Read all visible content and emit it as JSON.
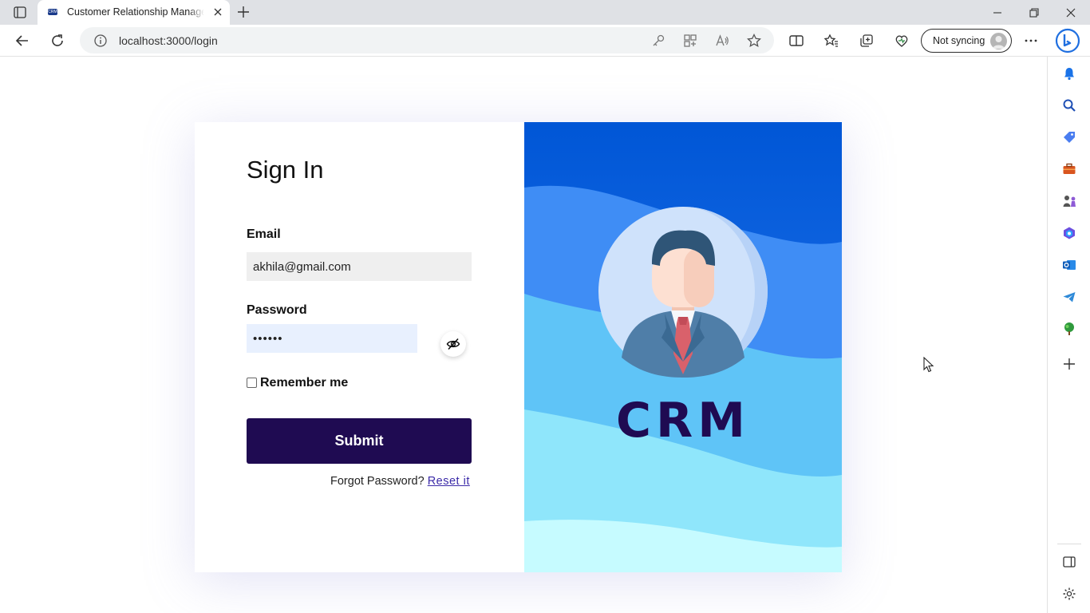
{
  "browser": {
    "tab_title": "Customer Relationship Management",
    "favicon_text": "CRM",
    "url": "localhost:3000/login",
    "sync_label": "Not syncing"
  },
  "login": {
    "title": "Sign In",
    "email_label": "Email",
    "email_value": "akhila@gmail.com",
    "password_label": "Password",
    "password_value": "••••••",
    "remember_label": "Remember me",
    "remember_checked": false,
    "submit_label": "Submit",
    "forgot_text": "Forgot Password?",
    "reset_link": "Reset it"
  },
  "brand": {
    "logo_text": "CRM"
  },
  "colors": {
    "submit_bg": "#1f0b52",
    "panel_top": "#0057d8",
    "panel_bottom": "#c9fbff",
    "logo_text": "#1f0b52"
  },
  "icons": {
    "toolbar": [
      "back-icon",
      "refresh-icon",
      "info-icon",
      "key-icon",
      "apps-icon",
      "read-aloud-icon",
      "favorite-star-icon",
      "split-screen-icon",
      "favorites-icon",
      "collections-icon",
      "browser-essentials-icon",
      "more-icon",
      "bing-copilot-icon"
    ],
    "sidebar": [
      "bell-icon",
      "search-icon",
      "shopping-tag-icon",
      "toolbox-icon",
      "games-icon",
      "office-icon",
      "outlook-icon",
      "telegram-icon",
      "tree-icon",
      "add-icon",
      "sidebar-toggle-icon",
      "settings-icon"
    ]
  }
}
